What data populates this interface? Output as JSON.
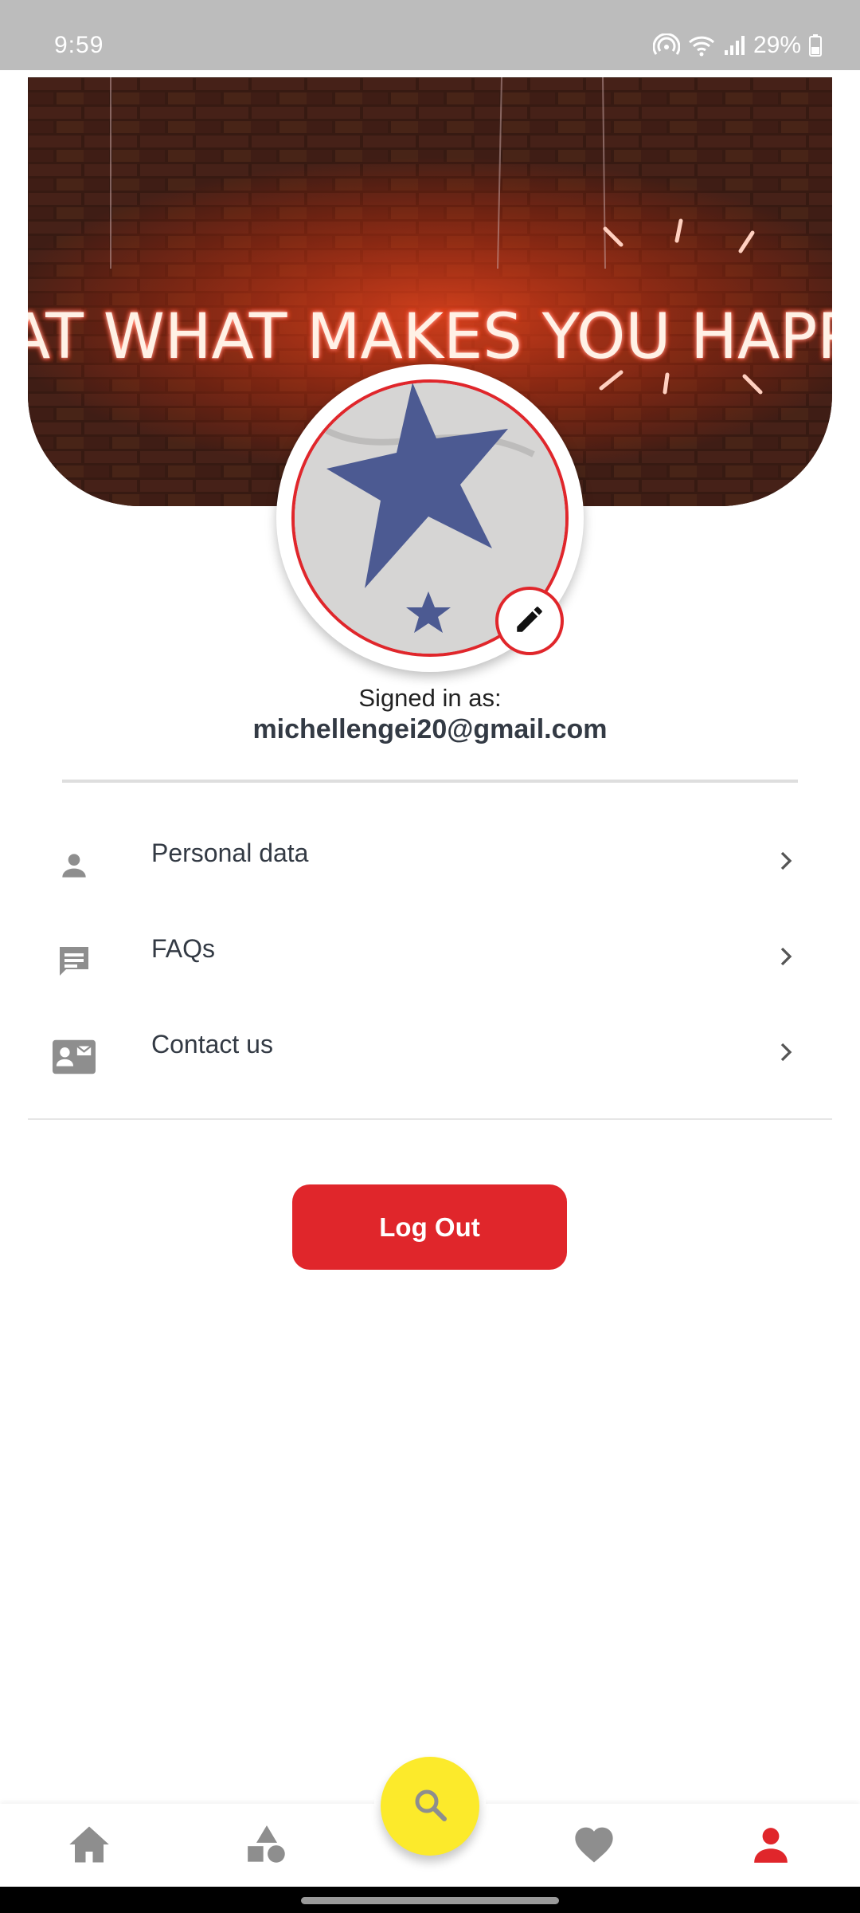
{
  "status_bar": {
    "time": "9:59",
    "battery": "29%"
  },
  "banner": {
    "neon_text": "EAT WHAT MAKES YOU HAPPY"
  },
  "profile": {
    "signed_in_label": "Signed in as:",
    "email": "michellengei20@gmail.com"
  },
  "menu": [
    {
      "label": "Personal data",
      "icon": "person-icon"
    },
    {
      "label": "FAQs",
      "icon": "chat-icon"
    },
    {
      "label": "Contact us",
      "icon": "contact-card-icon"
    }
  ],
  "logout_label": "Log Out",
  "bottom_nav": {
    "items": [
      "home-icon",
      "categories-icon",
      "search-icon",
      "favorites-icon",
      "profile-icon"
    ],
    "active": "profile-icon"
  },
  "colors": {
    "accent": "#e0262b",
    "fab": "#fcea2b",
    "icon_gray": "#8e8e8e"
  }
}
